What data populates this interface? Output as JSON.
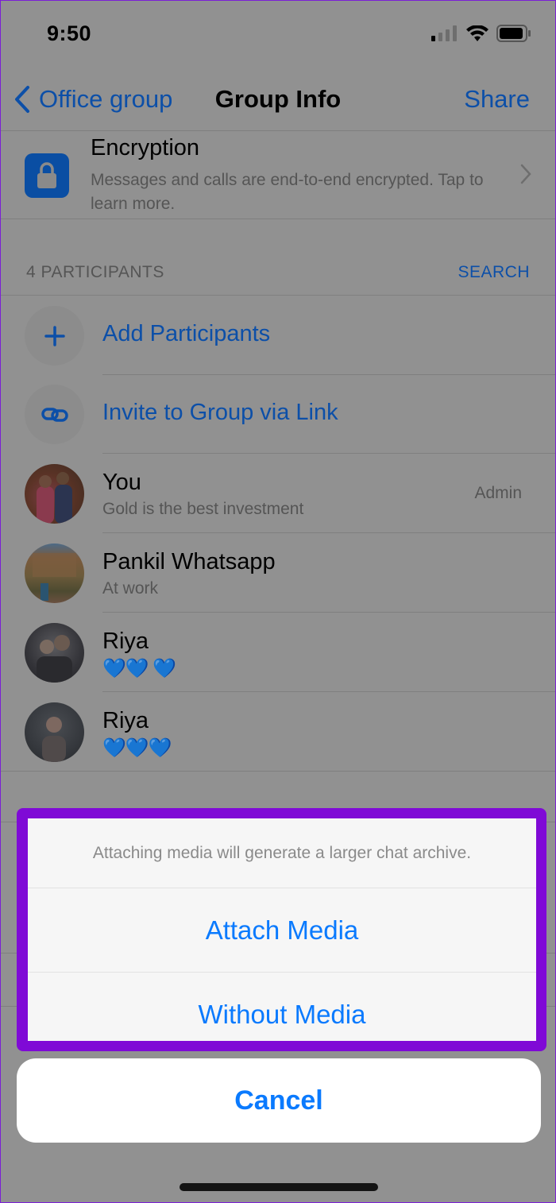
{
  "status_bar": {
    "time": "9:50",
    "icons": [
      "cellular-signal-icon",
      "wifi-icon",
      "battery-icon"
    ]
  },
  "nav": {
    "back_label": "Office group",
    "title": "Group Info",
    "share_label": "Share"
  },
  "encryption": {
    "title": "Encryption",
    "subtitle": "Messages and calls are end-to-end encrypted. Tap to learn more.",
    "icon": "lock-icon"
  },
  "participants_section": {
    "header": "4 PARTICIPANTS",
    "search_label": "SEARCH",
    "actions": [
      {
        "label": "Add Participants",
        "icon": "plus-icon"
      },
      {
        "label": "Invite to Group via Link",
        "icon": "link-icon"
      }
    ],
    "members": [
      {
        "name": "You",
        "status": "Gold is the best investment",
        "role": "Admin"
      },
      {
        "name": "Pankil Whatsapp",
        "status": "At work",
        "role": ""
      },
      {
        "name": "Riya",
        "status": "💙💙 💙",
        "role": ""
      },
      {
        "name": "Riya",
        "status": "💙💙💙",
        "role": ""
      }
    ]
  },
  "action_sheet": {
    "message": "Attaching media will generate a larger chat archive.",
    "options": [
      "Attach Media",
      "Without Media"
    ],
    "cancel_label": "Cancel",
    "highlight_color": "#7f0ad6"
  },
  "colors": {
    "accent": "#0a7afe",
    "dimmed_accent": "#0c4fa8",
    "overlay_bg": "#919191"
  }
}
